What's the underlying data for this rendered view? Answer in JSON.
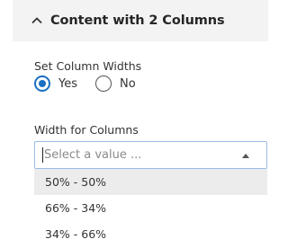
{
  "section": {
    "title": "Content with 2 Columns",
    "toggle_icon": "chevron-up-icon"
  },
  "column_widths": {
    "label": "Set Column Widths",
    "options": [
      {
        "label": "Yes",
        "selected": true
      },
      {
        "label": "No",
        "selected": false
      }
    ]
  },
  "width_select": {
    "label": "Width for Columns",
    "placeholder": "Select a value ...",
    "options": [
      "50% - 50%",
      "66% - 34%",
      "34% - 66%"
    ],
    "highlighted_index": 0
  },
  "colors": {
    "accent": "#1a6fc2",
    "header_bg": "#f3f3f3",
    "highlight_bg": "#ececec"
  }
}
